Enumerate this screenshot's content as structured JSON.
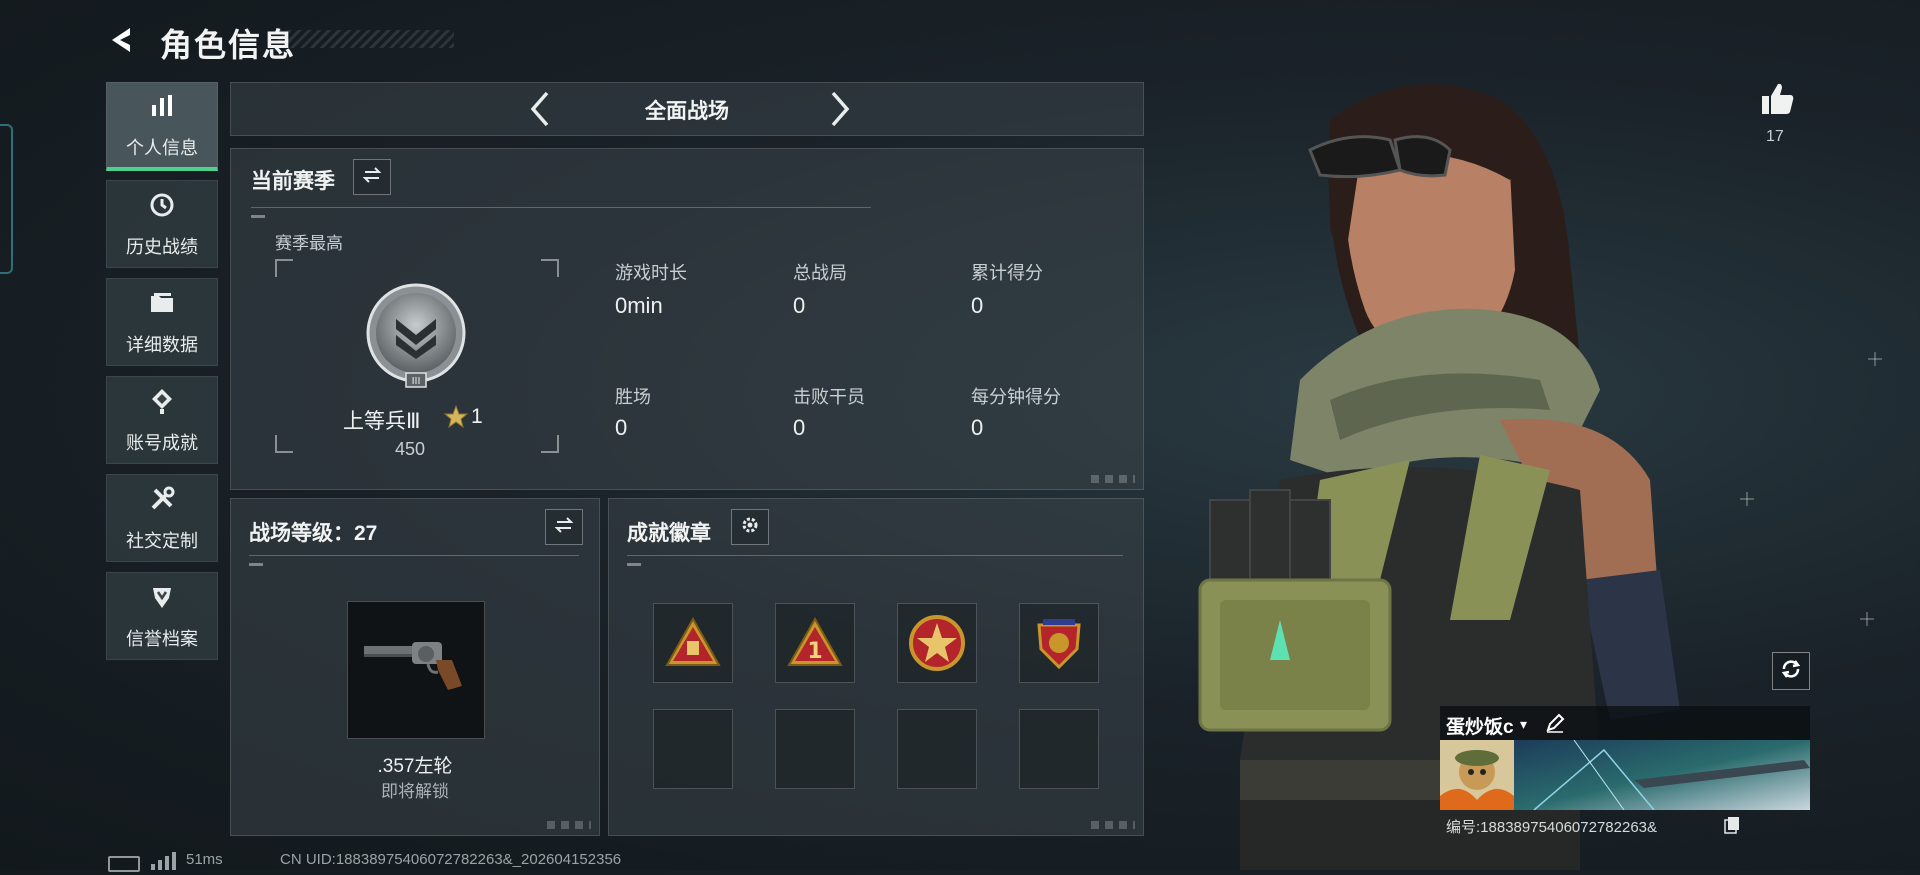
{
  "header": {
    "title": "角色信息"
  },
  "sidebar": {
    "items": [
      {
        "label": "个人信息",
        "icon": "bar-chart-icon",
        "active": true
      },
      {
        "label": "历史战绩",
        "icon": "history-clock-icon",
        "active": false
      },
      {
        "label": "详细数据",
        "icon": "folder-icon",
        "active": false
      },
      {
        "label": "账号成就",
        "icon": "achievement-icon",
        "active": false
      },
      {
        "label": "社交定制",
        "icon": "tools-icon",
        "active": false
      },
      {
        "label": "信誉档案",
        "icon": "shield-icon",
        "active": false
      }
    ]
  },
  "mode": {
    "label": "全面战场"
  },
  "season": {
    "title": "当前赛季",
    "best_label": "赛季最高",
    "rank_name": "上等兵Ⅲ",
    "rank_stars": "1",
    "rank_score": "450",
    "stats": [
      {
        "label": "游戏时长",
        "value": "0min"
      },
      {
        "label": "总战局",
        "value": "0"
      },
      {
        "label": "累计得分",
        "value": "0"
      },
      {
        "label": "胜场",
        "value": "0"
      },
      {
        "label": "击败干员",
        "value": "0"
      },
      {
        "label": "每分钟得分",
        "value": "0"
      }
    ]
  },
  "level": {
    "title": "战场等级：27",
    "weapon_name": ".357左轮",
    "weapon_status": "即将解锁"
  },
  "badges": {
    "title": "成就徽章"
  },
  "footer": {
    "ping": "51ms",
    "uid": "CN UID:18838975406072782263&_202604152356"
  },
  "profile": {
    "likes": "17",
    "name": "蛋炒饭c",
    "id_line": "编号:18838975406072782263&"
  },
  "colors": {
    "accent": "#4bd08f",
    "panel": "#3a4448",
    "badge_gold": "#c9962b",
    "badge_red": "#b3252a"
  }
}
